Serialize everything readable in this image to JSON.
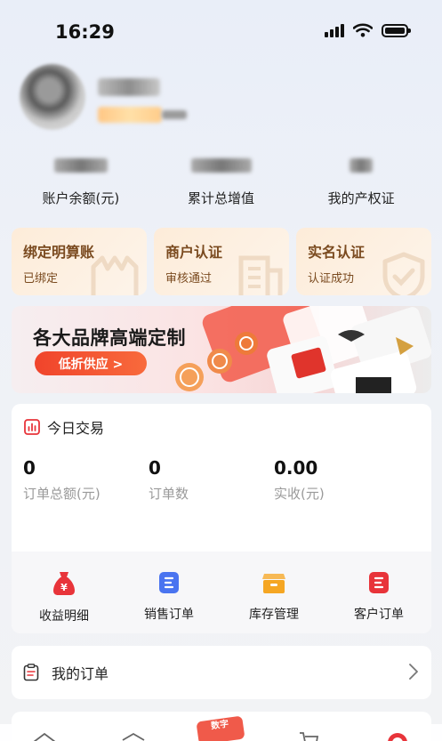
{
  "status_bar": {
    "time": "16:29"
  },
  "stats": [
    {
      "label": "账户余额(元)"
    },
    {
      "label": "累计总增值"
    },
    {
      "label": "我的产权证"
    }
  ],
  "cert_cards": [
    {
      "title": "绑定明算账",
      "status": "已绑定",
      "icon": "storefront-icon"
    },
    {
      "title": "商户认证",
      "status": "审核通过",
      "icon": "building-icon"
    },
    {
      "title": "实名认证",
      "status": "认证成功",
      "icon": "shield-check-icon"
    }
  ],
  "banner": {
    "headline": "各大品牌高端定制",
    "button_label": "低折供应 >",
    "accent": "#f0442b"
  },
  "trade": {
    "title": "今日交易",
    "metrics": [
      {
        "value": "0",
        "label": "订单总额(元)"
      },
      {
        "value": "0",
        "label": "订单数"
      },
      {
        "value": "0.00",
        "label": "实收(元)"
      }
    ],
    "quick_actions": [
      {
        "label": "收益明细",
        "icon": "money-bag-icon",
        "color": "#e8343a"
      },
      {
        "label": "销售订单",
        "icon": "list-doc-icon",
        "color": "#4a74f0"
      },
      {
        "label": "库存管理",
        "icon": "box-icon",
        "color": "#f5a623"
      },
      {
        "label": "客户订单",
        "icon": "list-doc-icon",
        "color": "#e8343a"
      }
    ]
  },
  "orders": {
    "title": "我的订单"
  },
  "tabbar": {
    "badge": "数字"
  }
}
